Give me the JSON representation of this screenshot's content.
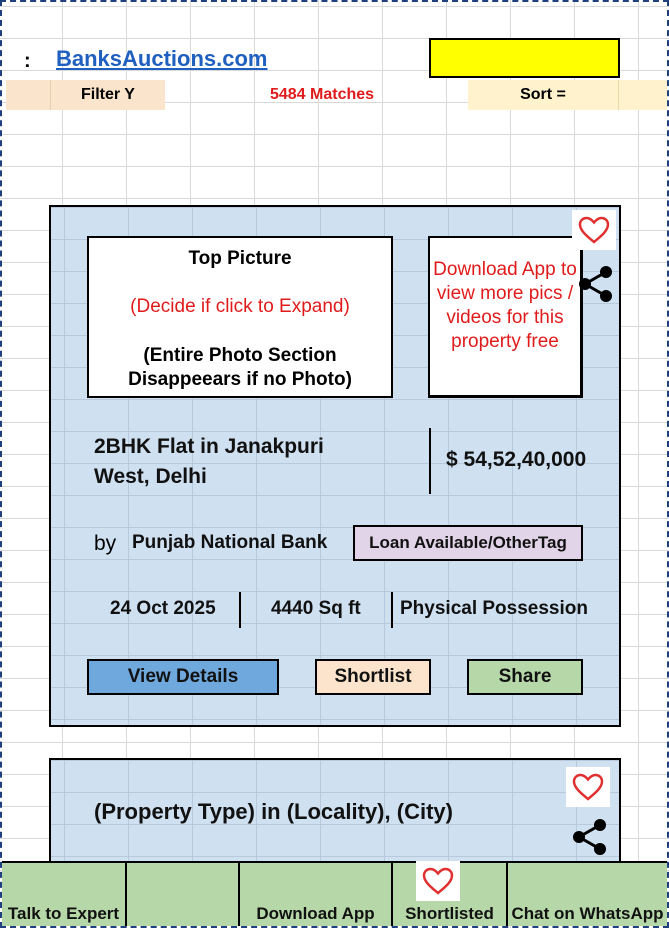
{
  "header": {
    "colon": ":",
    "site_link": "BanksAuctions.com",
    "highlight_color": "#ffff00",
    "filter_label": "Filter Y",
    "matches_label": "5484 Matches",
    "sort_label": "Sort ="
  },
  "listing1": {
    "photo": {
      "title": "Top Picture",
      "subtitle": "(Decide if click to Expand)",
      "note": "(Entire Photo Section Disappeears if no Photo)"
    },
    "download_note": "Download App to view more pics / videos for this property free",
    "favorite_icon": "heart-icon",
    "share_icon": "share-icon",
    "title_line1": "2BHK Flat in Janakpuri",
    "title_line2": "West, Delhi",
    "price": "$ 54,52,40,000",
    "by_label": "by",
    "bank": "Punjab National Bank",
    "tag": "Loan Available/OtherTag",
    "date": "24 Oct 2025",
    "area": "4440 Sq ft",
    "possession": "Physical Possession",
    "buttons": {
      "view_details": "View Details",
      "shortlist": "Shortlist",
      "share": "Share"
    }
  },
  "listing2": {
    "title": "(Property Type) in (Locality), (City)",
    "favorite_icon": "heart-icon",
    "share_icon": "share-icon"
  },
  "bottom_nav": {
    "talk_to_expert": "Talk to Expert",
    "blank": "",
    "download_app": "Download App",
    "shortlisted": "Shortlisted",
    "chat": "Chat on WhatsApp"
  },
  "colors": {
    "card_bg": "#cfe0f1",
    "accent_red": "#e01b1b",
    "link_blue": "#1f5fbf",
    "view_btn": "#6fa8dc",
    "shortlist_btn": "#fce4cc",
    "share_btn": "#b6d7a8",
    "nav_bg": "#b6d7a8",
    "tag_bg": "#e2d4e8"
  }
}
